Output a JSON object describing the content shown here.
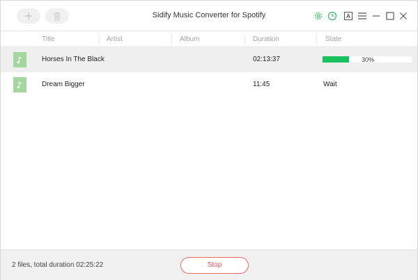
{
  "app": {
    "title": "Sidify Music Converter for Spotify"
  },
  "toolbar": {
    "add_icon": "plus-icon",
    "delete_icon": "trash-icon",
    "settings_icon": "gear-icon",
    "history_icon": "clock-icon",
    "font_icon": "font-a-icon",
    "menu_icon": "hamburger-menu-icon",
    "minimize_icon": "minimize-icon",
    "maximize_icon": "maximize-icon",
    "close_icon": "close-icon",
    "accent_color": "#3dbb6c"
  },
  "table": {
    "columns": [
      "Title",
      "Artist",
      "Album",
      "Duration",
      "State"
    ],
    "rows": [
      {
        "title": "Horses In The Black",
        "artist": "",
        "album": "",
        "duration": "02:13:37",
        "state": "30%",
        "progress": 0.3,
        "selected": true
      },
      {
        "title": "Dream Bigger",
        "artist": "",
        "album": "",
        "duration": "11:45",
        "state": "Wait",
        "progress": null,
        "selected": false
      }
    ],
    "thumb_color": "#a6d6a0",
    "progress_color": "#18c060"
  },
  "footer": {
    "summary": "2 files, total duration 02:25:22",
    "stop_label": "Stop",
    "stop_color": "#e05050"
  }
}
